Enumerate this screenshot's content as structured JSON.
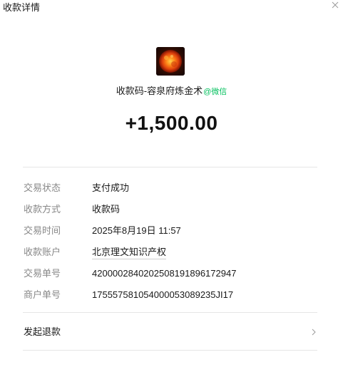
{
  "window": {
    "title": "收款详情"
  },
  "merchant": {
    "name": "收款码-容泉府炼金术",
    "platform_tag": "@微信",
    "logo": "sun-logo"
  },
  "amount": "+1,500.00",
  "details": [
    {
      "label": "交易状态",
      "value": "支付成功"
    },
    {
      "label": "收款方式",
      "value": "收款码"
    },
    {
      "label": "交易时间",
      "value": "2025年8月19日 11:57"
    },
    {
      "label": "收款账户",
      "value": "北京理文知识产权"
    },
    {
      "label": "交易单号",
      "value": "4200002840202508191896172947"
    },
    {
      "label": "商户单号",
      "value": "175557581054000053089235JI17"
    }
  ],
  "refund": {
    "label": "发起退款"
  },
  "colors": {
    "wechat_green": "#07c160",
    "label_gray": "#888888",
    "divider": "#e6e6e6"
  },
  "icons": {
    "close": "close-icon",
    "chevron": "chevron-right-icon"
  }
}
